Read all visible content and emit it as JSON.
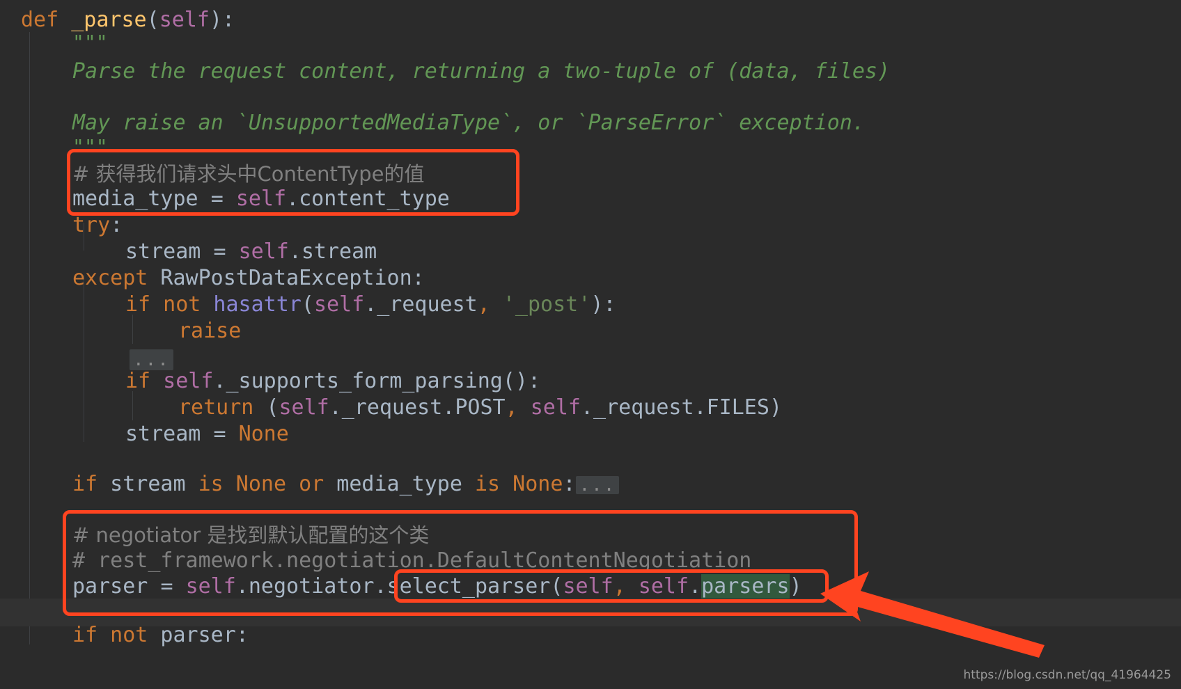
{
  "editor": {
    "language": "Python",
    "theme": "darcula-dark",
    "background_color": "#2b2b2b",
    "default_text_color": "#a9b7c6",
    "keyword_color": "#cc7832",
    "function_color": "#ffc66d",
    "self_color": "#b06ea5",
    "builtin_color": "#8a86d6",
    "string_color": "#6a8759",
    "docstring_color": "#629755",
    "comment_color": "#808080",
    "search_highlight_color": "#32593d",
    "annotation_color": "#ff4420"
  },
  "code": {
    "line_01": {
      "kw_def": "def",
      "fn_name": " _parse",
      "open_paren": "(",
      "self": "self",
      "close_paren": ")",
      "colon": ":"
    },
    "line_02": {
      "docstring_open": "\"\"\""
    },
    "line_03": {
      "text": "Parse the request content, returning a two-tuple of (data, files)"
    },
    "line_04": {
      "text": ""
    },
    "line_05": {
      "text": "May raise an `UnsupportedMediaType`, or `ParseError` exception."
    },
    "line_06": {
      "docstring_close": "\"\"\""
    },
    "line_07": {
      "comment": "# 获得我们请求头中ContentType的值"
    },
    "line_08": {
      "var": "media_type ",
      "eq": "= ",
      "self": "self",
      "attr": ".content_type"
    },
    "line_09": {
      "kw_try": "try",
      "colon": ":"
    },
    "line_10": {
      "var": "stream ",
      "eq": "= ",
      "self": "self",
      "attr": ".stream"
    },
    "line_11": {
      "kw_except": "except",
      "exc": " RawPostDataException",
      "colon": ":"
    },
    "line_12": {
      "kw_if": "if",
      "kw_not": " not",
      "builtin": " hasattr",
      "open_paren": "(",
      "self": "self",
      "attr": "._request",
      "comma": ",",
      "string": " '_post'",
      "close_paren": ")",
      "colon": ":"
    },
    "line_13": {
      "kw_raise": "raise"
    },
    "line_14": {
      "fold": "..."
    },
    "line_15": {
      "kw_if": "if",
      "self": " self",
      "call": "._supports_form_parsing()",
      "colon": ":"
    },
    "line_16": {
      "kw_return": "return",
      "open_paren": " (",
      "self1": "self",
      "attr1": "._request.POST",
      "comma": ",",
      "self2": " self",
      "attr2": "._request.FILES",
      "close_paren": ")"
    },
    "line_17": {
      "var": "stream ",
      "eq": "= ",
      "kw_none": "None"
    },
    "line_18": {
      "text": ""
    },
    "line_19": {
      "kw_if": "if",
      "var1": " stream ",
      "kw_is1": "is",
      "kw_none1": " None",
      "kw_or": " or",
      "var2": " media_type ",
      "kw_is2": "is",
      "kw_none2": " None",
      "colon": ":",
      "fold": "..."
    },
    "line_20": {
      "text": ""
    },
    "line_21": {
      "comment": "# negotiator 是找到默认配置的这个类"
    },
    "line_22": {
      "comment": "# rest_framework.negotiation.DefaultContentNegotiation"
    },
    "line_23": {
      "var": "parser ",
      "eq": "= ",
      "self1": "self",
      "attr1": ".negotiator",
      "dot": ".",
      "call": "select_parser",
      "open_paren": "(",
      "self2": "self",
      "comma": ",",
      "self3": " self",
      "dot2": ".",
      "highlighted": "parsers",
      "close_paren": ")"
    },
    "line_24": {
      "kw_if": "if",
      "kw_not": " not",
      "var": " parser",
      "colon": ":"
    }
  },
  "annotations": {
    "box_1_label": "highlight-media-type-block",
    "box_2_label": "highlight-negotiator-block",
    "box_3_label": "highlight-select-parser-call",
    "arrow_label": "pointer-arrow-to-select-parser"
  },
  "watermark": {
    "url": "https://blog.csdn.net/qq_41964425"
  }
}
